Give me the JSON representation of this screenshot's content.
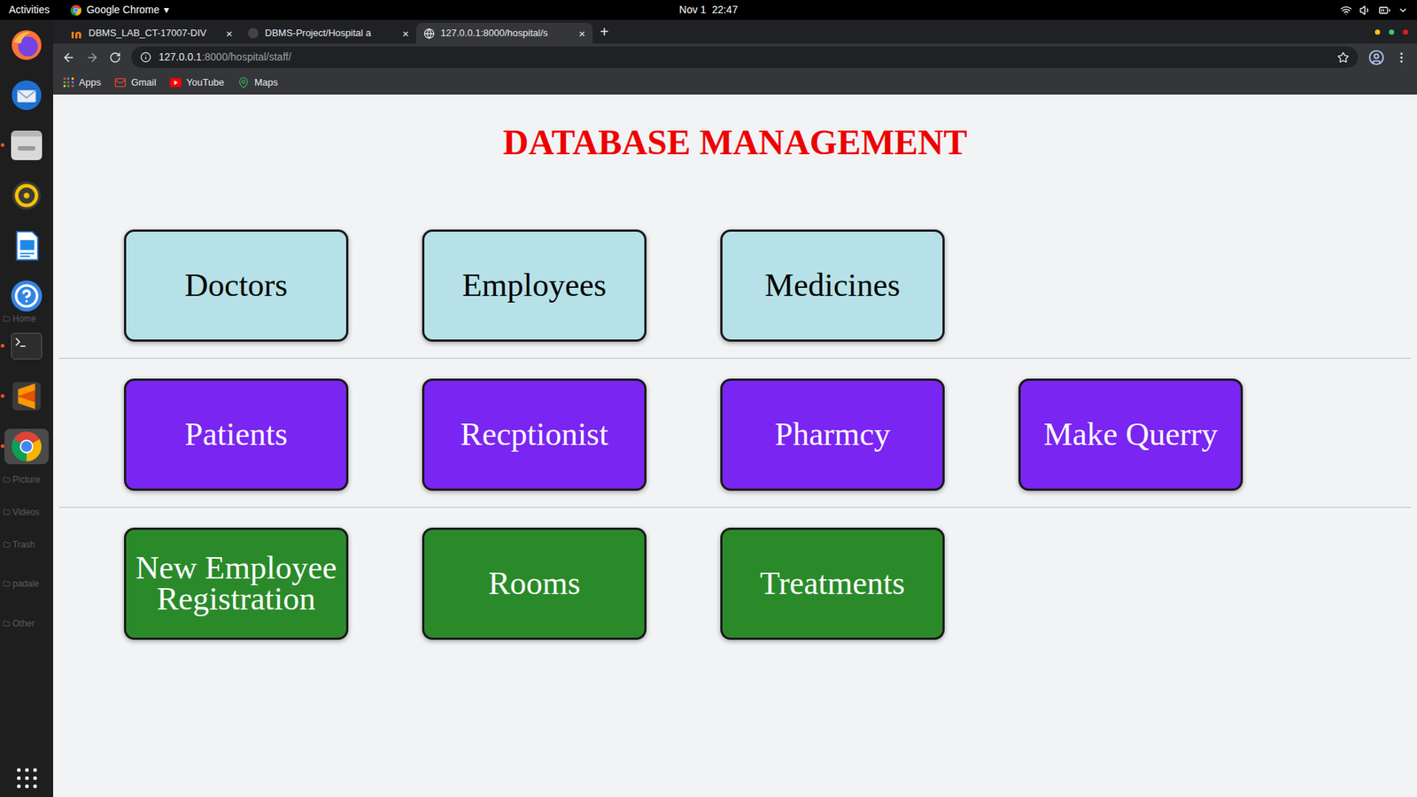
{
  "topbar": {
    "activities": "Activities",
    "app": "Google Chrome",
    "caret": "▾",
    "clock": "Nov 1  22:47"
  },
  "dock": {
    "apps": [
      {
        "kind": "firefox",
        "running": false,
        "selected": false
      },
      {
        "kind": "thunderbird",
        "running": false,
        "selected": false
      },
      {
        "kind": "files",
        "running": true,
        "selected": false
      },
      {
        "kind": "rhythmbox",
        "running": false,
        "selected": false
      },
      {
        "kind": "writer",
        "running": false,
        "selected": false
      },
      {
        "kind": "help",
        "running": false,
        "selected": false
      },
      {
        "kind": "terminal",
        "running": true,
        "selected": false
      },
      {
        "kind": "sublime",
        "running": true,
        "selected": false
      },
      {
        "kind": "chrome",
        "running": true,
        "selected": true
      }
    ],
    "behind": [
      "Home",
      "Picture",
      "Videos",
      "Trash",
      "padale",
      "Other"
    ]
  },
  "browser": {
    "tabs": [
      {
        "label": "DBMS_LAB_CT-17007-DIV",
        "kind": "moodle",
        "selected": false
      },
      {
        "label": "DBMS-Project/Hospital a",
        "kind": "github",
        "selected": false
      },
      {
        "label": "127.0.0.1:8000/hospital/s",
        "kind": "globe",
        "selected": true
      }
    ],
    "tab_close": "×",
    "new_tab": "+",
    "address": {
      "host": "127.0.0.1",
      "path": ":8000/hospital/staff/"
    },
    "bookmarks": [
      {
        "label": "Apps",
        "kind": "apps"
      },
      {
        "label": "Gmail",
        "kind": "gmail"
      },
      {
        "label": "YouTube",
        "kind": "youtube"
      },
      {
        "label": "Maps",
        "kind": "maps"
      }
    ]
  },
  "page": {
    "title": "DATABASE MANAGEMENT",
    "rows": [
      {
        "color": "#b7e1e8",
        "kind": "light",
        "buttons": [
          "Doctors",
          "Employees",
          "Medicines"
        ]
      },
      {
        "color": "#7a25f2",
        "kind": "dark",
        "buttons": [
          "Patients",
          "Recptionist",
          "Pharmcy",
          "Make Querry"
        ]
      },
      {
        "color": "#2a8a2a",
        "kind": "dark",
        "buttons": [
          "New Employee Registration",
          "Rooms",
          "Treatments"
        ]
      }
    ]
  }
}
